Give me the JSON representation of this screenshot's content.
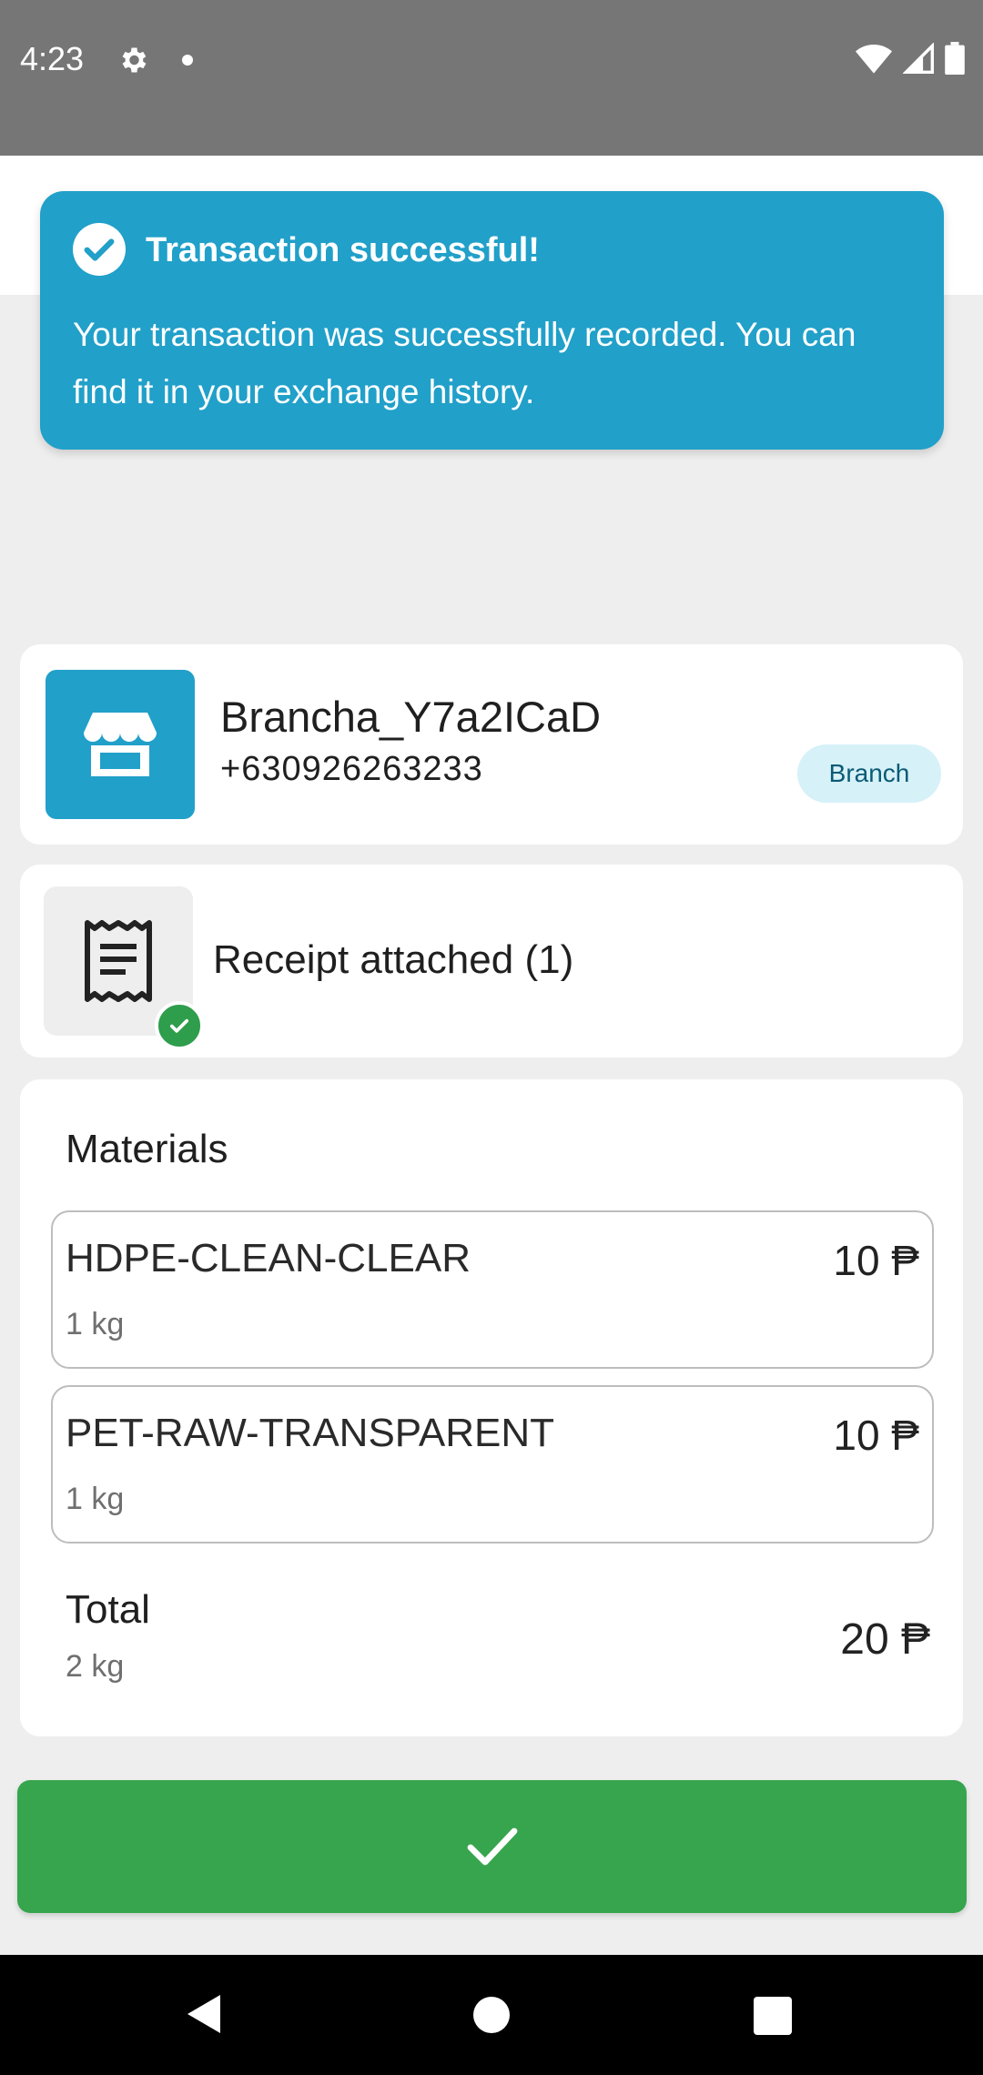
{
  "status_bar": {
    "time": "4:23",
    "icons": [
      "gear-icon",
      "notification-dot",
      "wifi-icon",
      "signal-icon",
      "battery-icon"
    ]
  },
  "toast": {
    "icon": "check-circle-icon",
    "title": "Transaction successful!",
    "message": "Your transaction was successfully recorded. You can find it in your exchange history.",
    "color": "#21a0c9"
  },
  "branch": {
    "icon": "storefront-icon",
    "name": "Brancha_Y7a2ICaD",
    "phone": "+630926263233",
    "badge": "Branch"
  },
  "receipt": {
    "icon": "receipt-icon",
    "label": "Receipt attached (1)"
  },
  "materials": {
    "title": "Materials",
    "items": [
      {
        "name": "HDPE-CLEAN-CLEAR",
        "weight": "1 kg",
        "price": "10 ₱"
      },
      {
        "name": "PET-RAW-TRANSPARENT",
        "weight": "1 kg",
        "price": "10 ₱"
      }
    ],
    "total": {
      "label": "Total",
      "weight": "2 kg",
      "price": "20 ₱"
    }
  },
  "confirm_button": {
    "icon": "checkmark-icon",
    "color": "#36a54d"
  },
  "nav": {
    "icons": [
      "back-icon",
      "home-icon",
      "recents-icon"
    ]
  }
}
